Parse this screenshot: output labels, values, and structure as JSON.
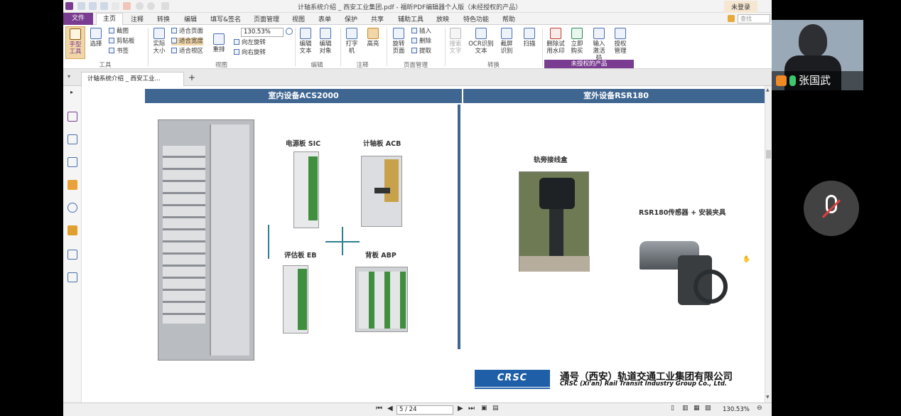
{
  "app": {
    "title": "计轴系统介绍 _ 西安工业集团.pdf - 福昕PDF编辑器个人版（未经授权的产品）",
    "login_label": "未登录",
    "search_placeholder": "查找",
    "accent_color": "#7a3c90"
  },
  "menu": {
    "file": "文件",
    "tabs": [
      "主页",
      "注释",
      "转换",
      "编辑",
      "填写&签名",
      "页面管理",
      "视图",
      "表单",
      "保护",
      "共享",
      "辅助工具",
      "放映",
      "特色功能",
      "帮助"
    ]
  },
  "ribbon": {
    "hand_tool": "手型工具",
    "select": "选择",
    "screenshot": "截图",
    "clipboard": "剪贴板",
    "bookmark": "书签",
    "group_tools": "工具",
    "actual_size": "实际大小",
    "fit_page": "适合页面",
    "fit_width": "适合宽度",
    "fit_visible": "适合视区",
    "zoom_value": "130.53%",
    "rotate_left": "向左旋转",
    "rotate_right": "向右旋转",
    "reflow": "重排",
    "group_view": "视图",
    "edit_text": "编辑文本",
    "edit_object": "编辑对象",
    "group_edit": "编辑",
    "typewriter": "打字机",
    "highlight": "高亮",
    "group_comment": "注释",
    "rotate_page": "旋转页面",
    "insert": "插入",
    "delete": "删除",
    "extract": "提取",
    "group_pages": "页面管理",
    "search_text": "搜索文字",
    "ocr": "OCR识别文本",
    "screen_ocr": "截屏识别",
    "scan": "扫描",
    "group_convert": "转换",
    "remove_watermark": "删除试用水印",
    "buy_now": "立即购买",
    "activation_code": "输入激活码",
    "license_mgmt": "授权管理",
    "group_unlicensed": "未授权的产品"
  },
  "doc_tab": {
    "label": "计轴系统介绍 _ 西安工业...",
    "new_tab": "+"
  },
  "slide": {
    "indoor_title": "室内设备ACS2000",
    "outdoor_title": "室外设备RSR180",
    "power_board": "电源板 SIC",
    "counting_board": "计轴板 ACB",
    "eval_board": "评估板 EB",
    "backplane": "背板 ABP",
    "trackside_box": "轨旁接线盒",
    "sensor": "RSR180传感器 + 安装夹具",
    "logo_text": "CRSC",
    "company_cn": "通号（西安）轨道交通工业集团有限公司",
    "company_en": "CRSC (Xi'an) Rail Transit Industry Group Co., Ltd."
  },
  "status": {
    "page_field": "5 / 24",
    "zoom": "130.53%"
  },
  "video": {
    "speaker_name": "张国武"
  }
}
